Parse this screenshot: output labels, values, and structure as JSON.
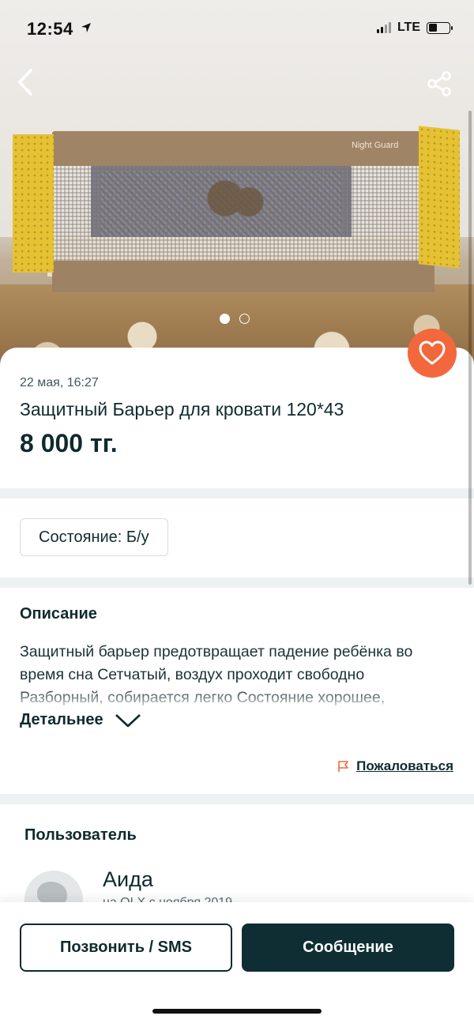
{
  "status_bar": {
    "time": "12:54",
    "network": "LTE"
  },
  "gallery": {
    "brand_text": "Night Guard",
    "pages": 2,
    "current_page": 1
  },
  "listing": {
    "date": "22 мая, 16:27",
    "title": "Защитный Барьер для кровати 120*43",
    "price": "8 000 тг.",
    "condition": "Состояние: Б/у"
  },
  "description": {
    "heading": "Описание",
    "text": "Защитный барьер предотвращает падение ребёнка во время сна Сетчатый, воздух проходит свободно Разборный, собирается легко Состояние хорошее,",
    "more_label": "Детальнее"
  },
  "report": {
    "label": "Пожаловаться"
  },
  "user": {
    "heading": "Пользователь",
    "name": "Аида",
    "subtitle": "на OLX с ноября 2019"
  },
  "actions": {
    "call_label": "Позвонить / SMS",
    "message_label": "Сообщение"
  },
  "colors": {
    "accent": "#f2683c",
    "primary_dark": "#0f2e33"
  }
}
